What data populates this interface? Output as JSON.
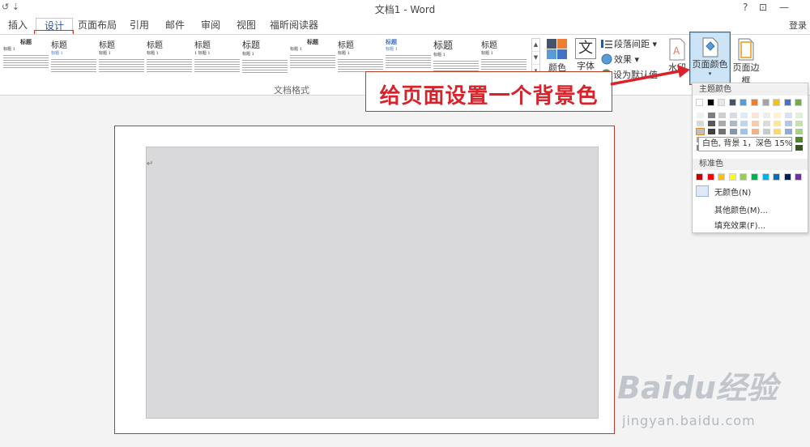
{
  "titlebar": {
    "quick_access": "↺  ⇣",
    "title": "文档1 - Word",
    "help": "?",
    "restore": "⊡",
    "minimize": "—"
  },
  "tabs": [
    {
      "label": "插入"
    },
    {
      "label": "设计",
      "active": true
    },
    {
      "label": "页面布局"
    },
    {
      "label": "引用"
    },
    {
      "label": "邮件"
    },
    {
      "label": "审阅"
    },
    {
      "label": "视图"
    },
    {
      "label": "福昕阅读器"
    }
  ],
  "signin": "登录",
  "ribbon": {
    "style_thumbs": [
      {
        "heading": "标题",
        "sub": "标题 1"
      },
      {
        "heading": "标题",
        "sub": "标题 1"
      },
      {
        "heading": "标题",
        "sub": "标题 1"
      },
      {
        "heading": "标题",
        "sub": "标题 1"
      },
      {
        "heading": "标题",
        "sub": "1 标题 1"
      },
      {
        "heading": "标题",
        "sub": "标题 1"
      },
      {
        "heading": "标题",
        "sub": "标题 1"
      },
      {
        "heading": "标题",
        "sub": "标题 1"
      },
      {
        "heading": "标题",
        "sub": "标题 1"
      },
      {
        "heading": "标题",
        "sub": "标题 1"
      },
      {
        "heading": "标题",
        "sub": "标题 1"
      }
    ],
    "group_label": "文档格式",
    "colors_btn": "颜色",
    "fonts_btn": "字体",
    "paragraph_spacing": "段落间距",
    "effects": "效果",
    "set_default": "设为默认值",
    "watermark": "水印",
    "page_color": "页面颜色",
    "page_borders": "页面边框"
  },
  "callout": "给页面设置一个背景色",
  "color_menu": {
    "theme_header": "主题颜色",
    "standard_header": "标准色",
    "tooltip": "白色, 背景 1，深色 15%",
    "no_color": "无颜色(N)",
    "more_colors": "其他颜色(M)...",
    "fill_effects": "填充效果(F)...",
    "theme_top": [
      "#ffffff",
      "#000000",
      "#e7e6e6",
      "#44546a",
      "#5b9bd5",
      "#ed7d31",
      "#a5a5a5",
      "#ffc000",
      "#4472c4",
      "#70ad47"
    ],
    "theme_shades": [
      [
        "#f2f2f2",
        "#d9d9d9",
        "#bfbfbf",
        "#a6a6a6",
        "#808080"
      ],
      [
        "#7f7f7f",
        "#595959",
        "#404040",
        "#262626",
        "#0d0d0d"
      ],
      [
        "#d0cece",
        "#aeaaaa",
        "#757171",
        "#3a3838",
        "#171616"
      ],
      [
        "#d6dce4",
        "#adb9ca",
        "#8496b0",
        "#333f4f",
        "#222a35"
      ],
      [
        "#deebf6",
        "#bdd7ee",
        "#9dc3e6",
        "#2e75b5",
        "#1f4e79"
      ],
      [
        "#fbe5d5",
        "#f7cbac",
        "#f4b183",
        "#c55a11",
        "#833c0b"
      ],
      [
        "#ededed",
        "#dbdbdb",
        "#c9c9c9",
        "#7b7b7b",
        "#525252"
      ],
      [
        "#fff2cc",
        "#fee599",
        "#ffd966",
        "#bf9000",
        "#7f6000"
      ],
      [
        "#d9e2f3",
        "#b4c6e7",
        "#8eaadb",
        "#2f5496",
        "#1f3864"
      ],
      [
        "#e2efd9",
        "#c5e0b3",
        "#a8d08d",
        "#538135",
        "#375623"
      ]
    ],
    "standard": [
      "#c00000",
      "#ff0000",
      "#ffc000",
      "#ffff00",
      "#92d050",
      "#00b050",
      "#00b0f0",
      "#0070c0",
      "#002060",
      "#7030a0"
    ]
  },
  "watermark": {
    "brand": "Baidu经验",
    "url": "jingyan.baidu.com"
  },
  "colors": {
    "accent": "#2b579a",
    "highlight": "#c0392b",
    "callout_text": "#d9222a",
    "page_bg": "#d9d9db"
  }
}
